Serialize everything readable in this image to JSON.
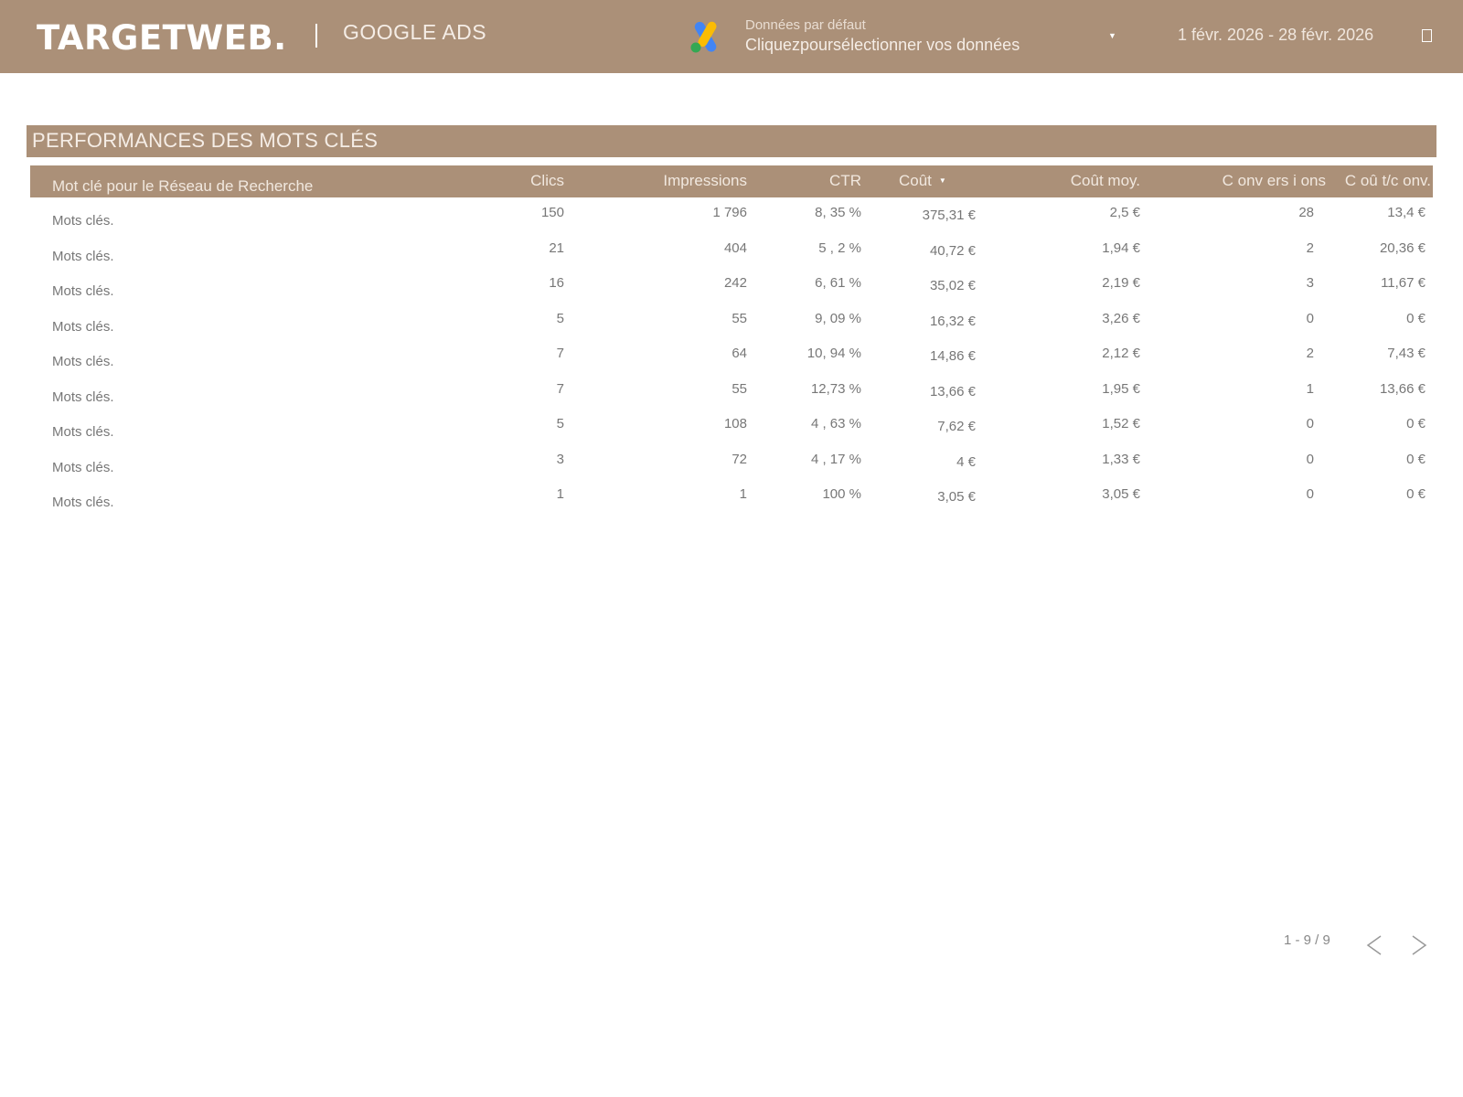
{
  "header": {
    "logo_text": "TARGETWEB.",
    "app_name": "GOOGLE ADS",
    "data_source_title": "Données par défaut",
    "data_source_subtitle": "Cliquezpoursélectionner vos données",
    "date_range": "1 févr. 2026 - 28 févr. 2026",
    "icons": [
      "google-ads-icon",
      "caret-down-icon",
      "calendar-icon"
    ]
  },
  "section": {
    "title": "PERFORMANCES DES MOTS CLÉS"
  },
  "table": {
    "columns": [
      "Mot clé pour le Réseau de Recherche",
      "Clics",
      "Impressions",
      "CTR",
      "Coût",
      "Coût moy.",
      "C onv ers i ons",
      "C oû t/c onv."
    ],
    "sort_column": "Coût",
    "rows": [
      [
        "Mots clés.",
        "150",
        "1 796",
        "8, 35 %",
        "375,31 €",
        "2,5 €",
        "28",
        "13,4 €"
      ],
      [
        "Mots clés.",
        "21",
        "404",
        "5 , 2 %",
        "40,72 €",
        "1,94 €",
        "2",
        "20,36 €"
      ],
      [
        "Mots clés.",
        "16",
        "242",
        "6, 61 %",
        "35,02 €",
        "2,19 €",
        "3",
        "11,67 €"
      ],
      [
        "Mots clés.",
        "5",
        "55",
        "9, 09 %",
        "16,32 €",
        "3,26 €",
        "0",
        "0 €"
      ],
      [
        "Mots clés.",
        "7",
        "64",
        "10, 94 %",
        "14,86 €",
        "2,12 €",
        "2",
        "7,43 €"
      ],
      [
        "Mots clés.",
        "7",
        "55",
        "12,73 %",
        "13,66 €",
        "1,95 €",
        "1",
        "13,66 €"
      ],
      [
        "Mots clés.",
        "5",
        "108",
        "4 , 63 %",
        "7,62 €",
        "1,52 €",
        "0",
        "0 €"
      ],
      [
        "Mots clés.",
        "3",
        "72",
        "4 , 17 %",
        "4 €",
        "1,33 €",
        "0",
        "0 €"
      ],
      [
        "Mots clés.",
        "1",
        "1",
        "100 %",
        "3,05 €",
        "3,05 €",
        "0",
        "0 €"
      ]
    ]
  },
  "pagination": {
    "label": "1 - 9 / 9",
    "icons": [
      "chevron-left-icon",
      "chevron-right-icon"
    ]
  },
  "colors": {
    "brand": "#ab9078",
    "header_text": "#f5ede6",
    "cell_text": "#777777"
  }
}
